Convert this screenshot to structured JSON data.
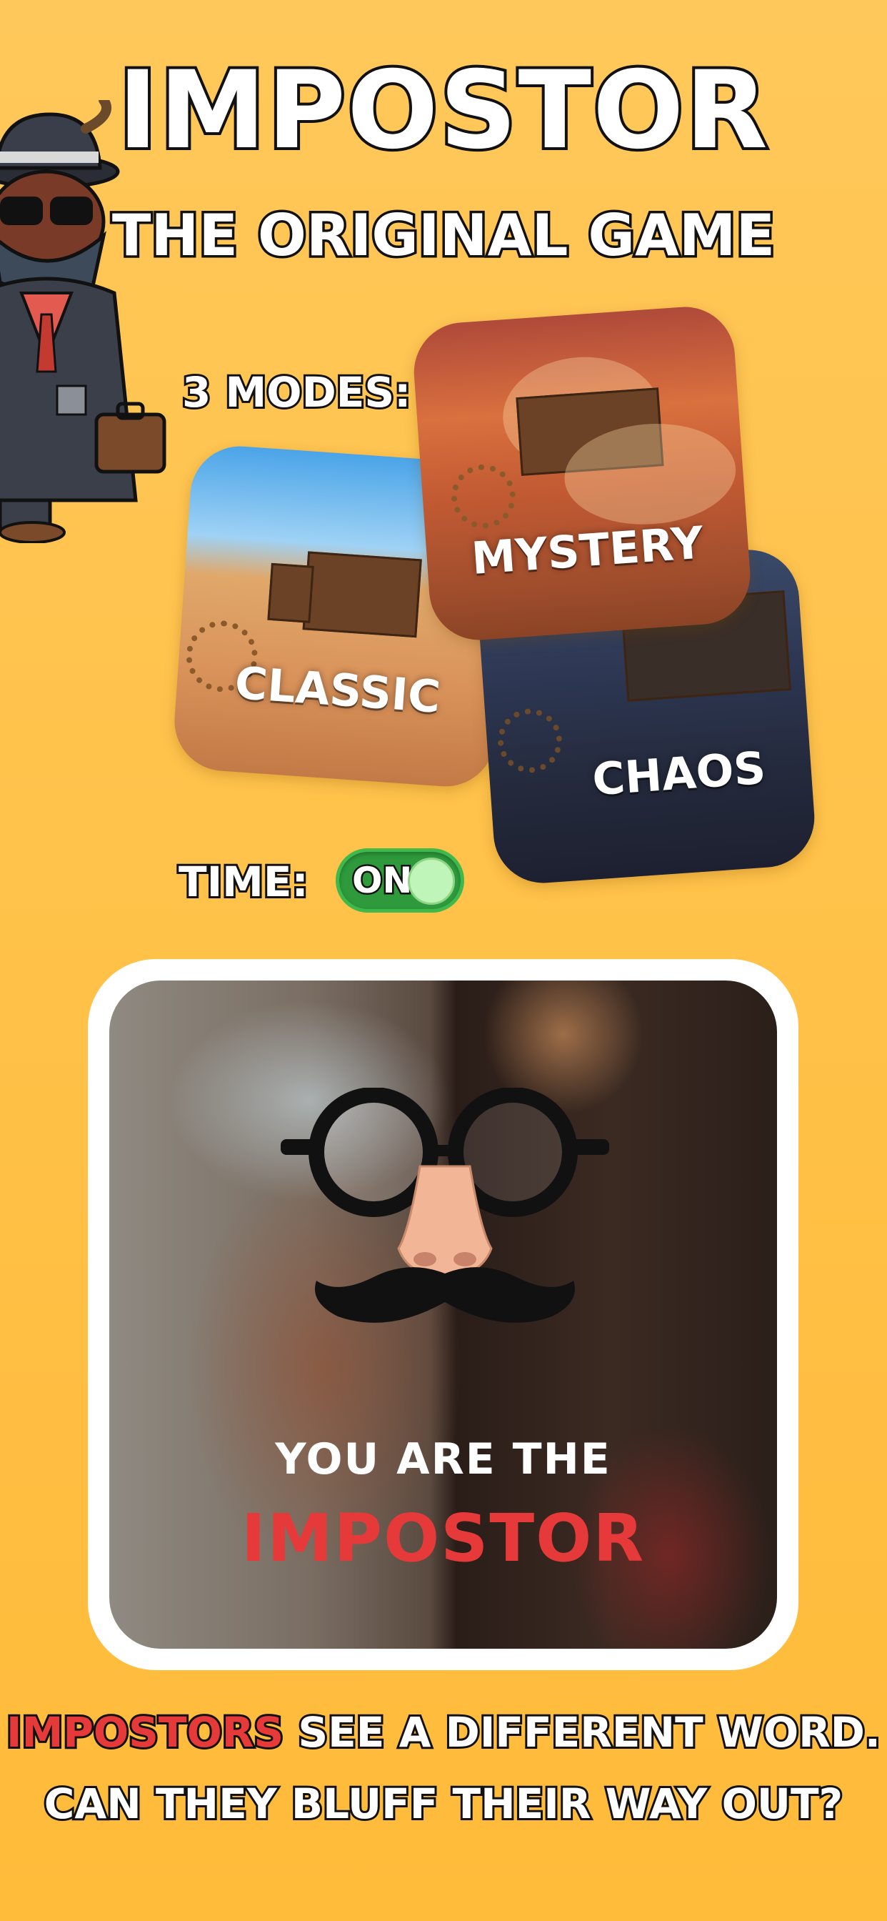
{
  "header": {
    "title": "IMPOSTOR",
    "subtitle": "THE ORIGINAL GAME"
  },
  "modes": {
    "label": "3 MODES:",
    "cards": [
      {
        "label": "CLASSIC"
      },
      {
        "label": "MYSTERY"
      },
      {
        "label": "CHAOS"
      }
    ]
  },
  "time": {
    "label": "TIME:",
    "toggle_text": "ON",
    "enabled": true
  },
  "panel": {
    "line1": "YOU ARE THE",
    "line2": "IMPOSTOR"
  },
  "footer": {
    "highlight": "IMPOSTORS",
    "line1_rest": " SEE A DIFFERENT WORD.",
    "line2": "CAN THEY BLUFF THEIR WAY OUT?"
  },
  "colors": {
    "background": "#ffc24a",
    "accent_red": "#e63a3a",
    "toggle_green": "#2e9a3c"
  }
}
